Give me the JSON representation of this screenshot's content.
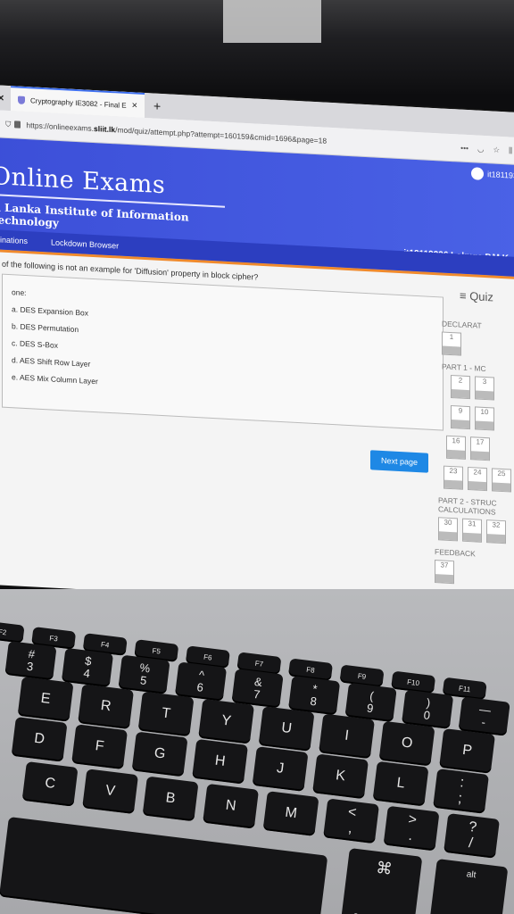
{
  "browser": {
    "tab_title": "Cryptography IE3082 - Final E",
    "url_prefix": "https://onlineexams.",
    "url_domain": "sliit.lk",
    "url_path": "/mod/quiz/attempt.php?attempt=160159&cmid=1696&page=18",
    "menu_dots": "•••"
  },
  "header": {
    "username_short": "it181193",
    "site_title": "Online Exams",
    "institute": "ri Lanka Institute of Information Technology",
    "nav_items": [
      "inations",
      "Lockdown Browser"
    ],
    "student": "it18119336 Lokuge P.M.K"
  },
  "question": {
    "text": "of the following is not an example for 'Diffusion' property in block cipher?",
    "select_label": "one:",
    "options": [
      "a. DES Expansion Box",
      "b. DES Permutation",
      "c. DES S-Box",
      "d. AES Shift Row Layer",
      "e. AES Mix Column Layer"
    ],
    "next_label": "Next page"
  },
  "quiz_nav": {
    "heading": "≡ Quiz",
    "declaration": "DECLARAT",
    "decl_items": [
      "1"
    ],
    "part1": "PART 1 - MC",
    "part1_rows": [
      [
        "2",
        "3"
      ],
      [
        "9",
        "10"
      ],
      [
        "16",
        "17"
      ],
      [
        "23",
        "24",
        "25"
      ]
    ],
    "part2": "PART 2 - STRUC CALCULATIONS",
    "part2_items": [
      "30",
      "31",
      "32"
    ],
    "feedback": "FEEDBACK",
    "feedback_items": [
      "37"
    ]
  },
  "keyboard": {
    "fkeys": [
      "F2",
      "F3",
      "F4",
      "F5",
      "F6",
      "F7",
      "F8",
      "F9",
      "F10",
      "F11"
    ],
    "number_row": [
      "#\n3",
      "$\n4",
      "%\n5",
      "^\n6",
      "&\n7",
      "*\n8",
      "(\n9",
      ")\n0",
      "—\n-"
    ],
    "qwerty_row": [
      "E",
      "R",
      "T",
      "Y",
      "U",
      "I",
      "O",
      "P",
      "{\n["
    ],
    "home_row": [
      "D",
      "F",
      "G",
      "H",
      "J",
      "K",
      "L",
      ":\n;"
    ],
    "bottom_row": [
      "C",
      "V",
      "B",
      "N",
      "M",
      "<\n,",
      ">\n.",
      "?\n/"
    ],
    "command": "command",
    "command_symbol": "⌘",
    "option": "option",
    "alt": "alt"
  }
}
